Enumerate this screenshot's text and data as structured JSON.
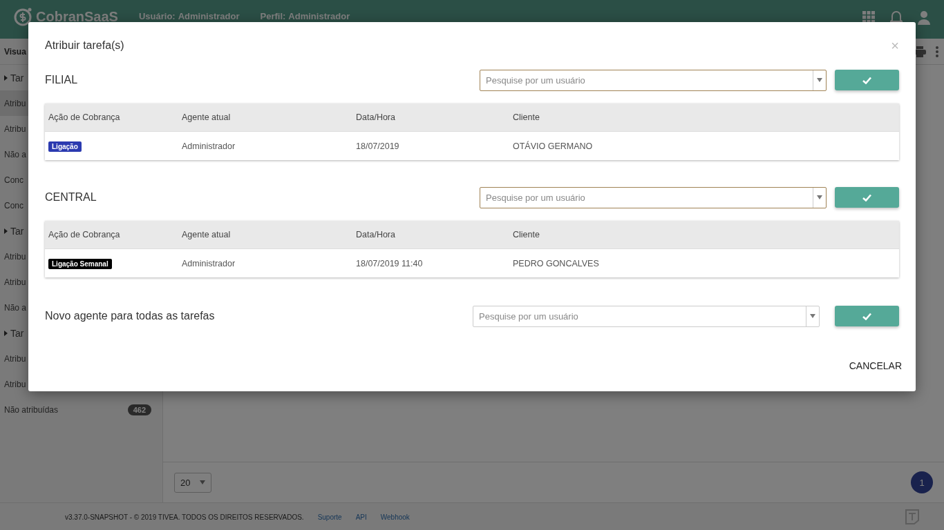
{
  "header": {
    "logo": "CobranSaaS",
    "user_label": "Usuário:",
    "user": "Administrador",
    "profile_label": "Perfil:",
    "profile": "Administrador"
  },
  "sidebar": {
    "title": "Visua",
    "items": [
      {
        "kind": "group",
        "label": "Tar"
      },
      {
        "kind": "item",
        "label": "Atribu",
        "selected": true
      },
      {
        "kind": "item",
        "label": "Atribu",
        "selected": false
      },
      {
        "kind": "item",
        "label": "Não a",
        "selected": false
      },
      {
        "kind": "item",
        "label": "Conc",
        "selected": false
      },
      {
        "kind": "item",
        "label": "Conc",
        "selected": false
      },
      {
        "kind": "group",
        "label": "Tar"
      },
      {
        "kind": "item",
        "label": "Atribu",
        "selected": false
      },
      {
        "kind": "item",
        "label": "Atribu",
        "selected": false
      },
      {
        "kind": "item",
        "label": "Não a",
        "selected": false
      },
      {
        "kind": "group",
        "label": "Tar"
      },
      {
        "kind": "item",
        "label": "Atribu",
        "selected": false
      },
      {
        "kind": "item",
        "label": "Atribu",
        "selected": false
      },
      {
        "kind": "item",
        "label": "Não atribuídas",
        "badge": "462",
        "selected": false
      }
    ]
  },
  "pagination": {
    "page_size": "20",
    "pages": [
      {
        "label": "1",
        "selected": true
      }
    ]
  },
  "footer": {
    "copyright": "v3.37.0-SNAPSHOT - © 2019 TIVEA. TODOS OS DIREITOS RESERVADOS.",
    "links": [
      "Suporte",
      "API",
      "Webhook"
    ]
  },
  "dialog": {
    "title": "Atribuir tarefa(s)",
    "close": "×",
    "sections": [
      {
        "heading": "FILIAL",
        "search": {
          "placeholder": "Pesquise por um usuário"
        },
        "columns": [
          "Ação de Cobrança",
          "Agente atual",
          "Data/Hora",
          "Cliente"
        ],
        "rows": [
          {
            "tag": {
              "label": "Ligação",
              "color": "#2b3ab0"
            },
            "agent": "Administrador",
            "datetime": "18/07/2019",
            "client": "OTÁVIO GERMANO"
          }
        ]
      },
      {
        "heading": "CENTRAL",
        "search": {
          "placeholder": "Pesquise por um usuário"
        },
        "columns": [
          "Ação de Cobrança",
          "Agente atual",
          "Data/Hora",
          "Cliente"
        ],
        "rows": [
          {
            "tag": {
              "label": "Ligação Semanal",
              "color": "#000000"
            },
            "agent": "Administrador",
            "datetime": "18/07/2019 11:40",
            "client": "PEDRO GONCALVES"
          }
        ]
      }
    ],
    "all": {
      "label": "Novo agente para todas as tarefas",
      "search": {
        "placeholder": "Pesquise por um usuário"
      }
    },
    "cancel": "CANCELAR"
  }
}
